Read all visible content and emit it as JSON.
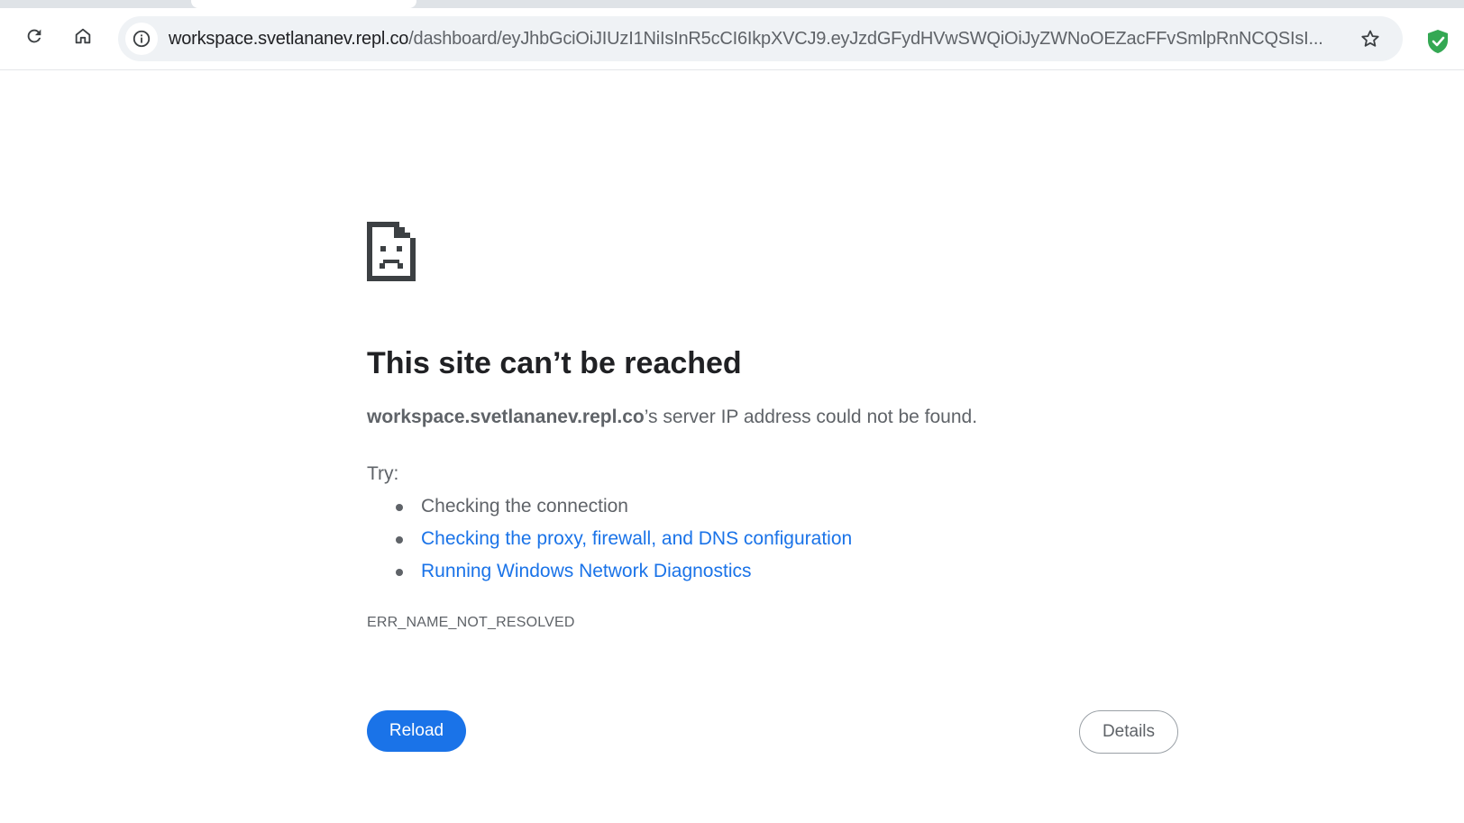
{
  "browser": {
    "url_host": "workspace.svetlananev.repl.co",
    "url_path": "/dashboard/eyJhbGciOiJIUzI1NiIsInR5cCI6IkpXVCJ9.eyJzdGFydHVwSWQiOiJyZWNoOEZacFFvSmlpRnNCQSIsI...",
    "icons": {
      "reload": "reload-icon",
      "home": "home-icon",
      "site_info": "info-icon",
      "bookmark": "star-icon",
      "extension": "shield-check-icon"
    },
    "extension_color": "#34a853"
  },
  "error_page": {
    "icon": "sad-document-icon",
    "title": "This site can’t be reached",
    "host": "workspace.svetlananev.repl.co",
    "message_suffix": "’s server IP address could not be found.",
    "try_label": "Try:",
    "suggestions": [
      {
        "text": "Checking the connection",
        "is_link": false
      },
      {
        "text": "Checking the proxy, firewall, and DNS configuration",
        "is_link": true
      },
      {
        "text": "Running Windows Network Diagnostics",
        "is_link": true
      }
    ],
    "error_code": "ERR_NAME_NOT_RESOLVED",
    "reload_label": "Reload",
    "details_label": "Details",
    "link_color": "#1a73e8",
    "primary_button_color": "#1a73e8"
  }
}
